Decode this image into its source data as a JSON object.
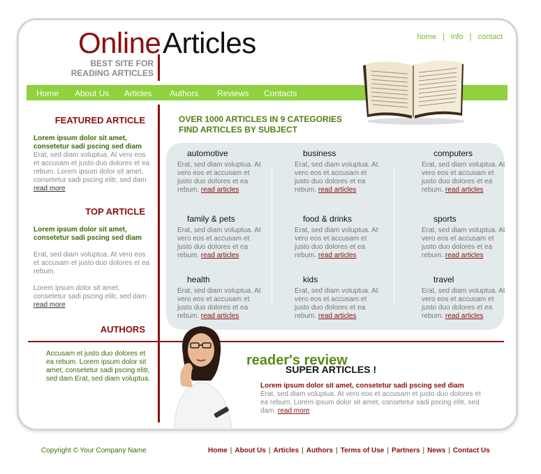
{
  "header": {
    "logo_online": "Online",
    "logo_articles": "Articles",
    "tagline_line1": "BEST SITE FOR",
    "tagline_line2": "READING ARTICLES",
    "top_links": [
      "home",
      "info",
      "contact"
    ]
  },
  "nav": {
    "items": [
      "Home",
      "About Us",
      "Articles",
      "Authors",
      "Reviews",
      "Contacts"
    ]
  },
  "sidebar": {
    "featured": {
      "title": "FEATURED ARTICLE",
      "lead": "Lorem ipsum dolor sit amet, consetetur sadi pscing sed diam",
      "text": "Erat, sed diam voluptua. At vero eos et accusam et justo duo dolores et ea rebum. Lorem ipsum dolor sit amet, consetetur sadi pscing elitr, sed dam",
      "more": "read more"
    },
    "top": {
      "title": "TOP ARTICLE",
      "lead": "Lorem ipsum dolor sit amet, consetetur sadi pscing sed diam",
      "text1": "Erat, sed diam voluptua. At vero eos et accusam et justo duo dolores et ea rebum.",
      "text2": "Lorem ipsum dolor sit amet, consetetur sadi pscing elitr, sed dam",
      "more": "read more"
    },
    "authors": {
      "title": "AUTHORS",
      "text": "Accusam et justo duo dolores et ea rebum. Lorem ipsum dolor sit amet, consetetur sadi pscing elitr, sed dam Erat, sed diam voluptua."
    }
  },
  "main": {
    "headline1": "OVER 1000 ARTICLES IN 9 CATEGORIES",
    "headline2": "FIND ARTICLES BY SUBJECT",
    "category_text": "Erat, sed diam voluptua. At vero eos et accusam et justo duo dolores et ea rebum.",
    "read_articles": "read articles",
    "categories": [
      "automotive",
      "business",
      "computers",
      "family & pets",
      "food & drinks",
      "sports",
      "health",
      "kids",
      "travel"
    ]
  },
  "review": {
    "title": "reader's review",
    "subtitle": "SUPER ARTICLES !",
    "lead": "Lorem ipsum dolor sit amet, consetetur sadi pscing sed diam",
    "text": "Erat, sed diam voluptua. At vero eos et accusam et justo duo dolores et ea rebum. Lorem ipsum dolor sit amet, consetetur sadi pscing elitr, sed dam",
    "more": "read more"
  },
  "footer": {
    "copyright": "Copyright © Your Company Name",
    "links": [
      "Home",
      "About Us",
      "Articles",
      "Authors",
      "Terms of Use",
      "Partners",
      "News",
      "Contact Us"
    ]
  },
  "colors": {
    "accent_red": "#8b0f0f",
    "nav_green": "#8fd13f",
    "text_green": "#3d6a08",
    "panel_bg": "#e3eaec"
  },
  "icons": [
    "open-book-image",
    "woman-reader-photo"
  ]
}
